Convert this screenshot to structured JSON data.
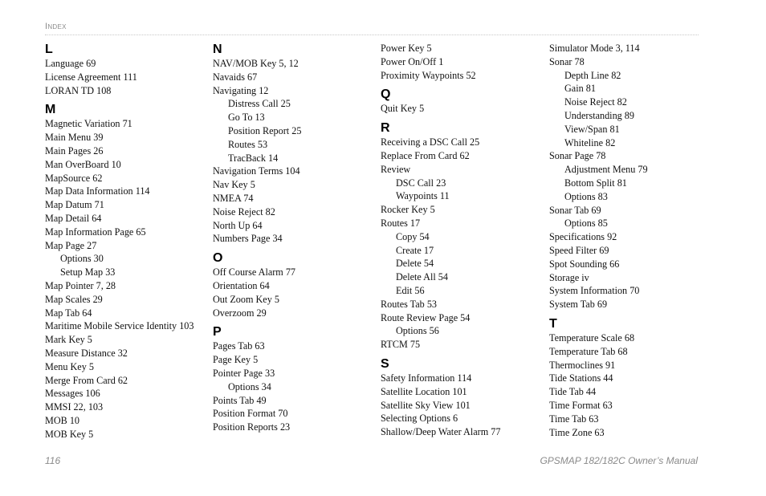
{
  "header": {
    "section_label": "Index"
  },
  "footer": {
    "page_number": "116",
    "manual_title": "GPSMAP 182/182C Owner’s Manual"
  },
  "columns": [
    {
      "sections": [
        {
          "letter": "L",
          "entries": [
            {
              "text": "Language  69",
              "sub": false
            },
            {
              "text": "License Agreement  111",
              "sub": false
            },
            {
              "text": "LORAN TD  108",
              "sub": false
            }
          ]
        },
        {
          "letter": "M",
          "entries": [
            {
              "text": "Magnetic Variation  71",
              "sub": false
            },
            {
              "text": "Main Menu  39",
              "sub": false
            },
            {
              "text": "Main Pages  26",
              "sub": false
            },
            {
              "text": "Man OverBoard  10",
              "sub": false
            },
            {
              "text": "MapSource  62",
              "sub": false
            },
            {
              "text": "Map Data Information  114",
              "sub": false
            },
            {
              "text": "Map Datum  71",
              "sub": false
            },
            {
              "text": "Map Detail  64",
              "sub": false
            },
            {
              "text": "Map Information Page  65",
              "sub": false
            },
            {
              "text": "Map Page  27",
              "sub": false
            },
            {
              "text": "Options  30",
              "sub": true
            },
            {
              "text": "Setup Map  33",
              "sub": true
            },
            {
              "text": "Map Pointer  7, 28",
              "sub": false
            },
            {
              "text": "Map Scales  29",
              "sub": false
            },
            {
              "text": "Map Tab  64",
              "sub": false
            },
            {
              "text": "Maritime Mobile Service Identity  103",
              "sub": false
            },
            {
              "text": "Mark Key  5",
              "sub": false
            },
            {
              "text": "Measure Distance  32",
              "sub": false
            },
            {
              "text": "Menu Key  5",
              "sub": false
            },
            {
              "text": "Merge From Card  62",
              "sub": false
            },
            {
              "text": "Messages  106",
              "sub": false
            },
            {
              "text": "MMSI  22, 103",
              "sub": false
            },
            {
              "text": "MOB  10",
              "sub": false
            },
            {
              "text": "MOB Key  5",
              "sub": false
            }
          ]
        }
      ]
    },
    {
      "sections": [
        {
          "letter": "N",
          "entries": [
            {
              "text": "NAV/MOB Key  5, 12",
              "sub": false
            },
            {
              "text": "Navaids  67",
              "sub": false
            },
            {
              "text": "Navigating  12",
              "sub": false
            },
            {
              "text": "Distress Call  25",
              "sub": true
            },
            {
              "text": "Go To  13",
              "sub": true
            },
            {
              "text": "Position Report  25",
              "sub": true
            },
            {
              "text": "Routes  53",
              "sub": true
            },
            {
              "text": "TracBack  14",
              "sub": true
            },
            {
              "text": "Navigation Terms  104",
              "sub": false
            },
            {
              "text": "Nav Key  5",
              "sub": false
            },
            {
              "text": "NMEA  74",
              "sub": false
            },
            {
              "text": "Noise Reject  82",
              "sub": false
            },
            {
              "text": "North Up  64",
              "sub": false
            },
            {
              "text": "Numbers Page  34",
              "sub": false
            }
          ]
        },
        {
          "letter": "O",
          "entries": [
            {
              "text": "Off Course Alarm  77",
              "sub": false
            },
            {
              "text": "Orientation  64",
              "sub": false
            },
            {
              "text": "Out Zoom Key  5",
              "sub": false
            },
            {
              "text": "Overzoom  29",
              "sub": false
            }
          ]
        },
        {
          "letter": "P",
          "entries": [
            {
              "text": "Pages Tab  63",
              "sub": false
            },
            {
              "text": "Page Key  5",
              "sub": false
            },
            {
              "text": "Pointer Page  33",
              "sub": false
            },
            {
              "text": "Options  34",
              "sub": true
            },
            {
              "text": "Points Tab  49",
              "sub": false
            },
            {
              "text": "Position Format  70",
              "sub": false
            },
            {
              "text": "Position Reports  23",
              "sub": false
            }
          ]
        }
      ]
    },
    {
      "sections": [
        {
          "letter": "",
          "entries": [
            {
              "text": "Power Key  5",
              "sub": false
            },
            {
              "text": "Power On/Off  1",
              "sub": false
            },
            {
              "text": "Proximity Waypoints  52",
              "sub": false
            }
          ]
        },
        {
          "letter": "Q",
          "entries": [
            {
              "text": "Quit Key  5",
              "sub": false
            }
          ]
        },
        {
          "letter": "R",
          "entries": [
            {
              "text": "Receiving a DSC Call  25",
              "sub": false
            },
            {
              "text": "Replace From Card  62",
              "sub": false
            },
            {
              "text": "Review",
              "sub": false
            },
            {
              "text": "DSC Call  23",
              "sub": true
            },
            {
              "text": "Waypoints  11",
              "sub": true
            },
            {
              "text": "Rocker Key  5",
              "sub": false
            },
            {
              "text": "Routes  17",
              "sub": false
            },
            {
              "text": "Copy  54",
              "sub": true
            },
            {
              "text": "Create  17",
              "sub": true
            },
            {
              "text": "Delete  54",
              "sub": true
            },
            {
              "text": "Delete All  54",
              "sub": true
            },
            {
              "text": "Edit  56",
              "sub": true
            },
            {
              "text": "Routes Tab  53",
              "sub": false
            },
            {
              "text": "Route Review Page  54",
              "sub": false
            },
            {
              "text": "Options  56",
              "sub": true
            },
            {
              "text": "RTCM  75",
              "sub": false
            }
          ]
        },
        {
          "letter": "S",
          "entries": [
            {
              "text": "Safety Information  114",
              "sub": false
            },
            {
              "text": "Satellite Location  101",
              "sub": false
            },
            {
              "text": "Satellite Sky View  101",
              "sub": false
            },
            {
              "text": "Selecting Options  6",
              "sub": false
            },
            {
              "text": "Shallow/Deep Water Alarm  77",
              "sub": false
            }
          ]
        }
      ]
    },
    {
      "sections": [
        {
          "letter": "",
          "entries": [
            {
              "text": "Simulator Mode  3, 114",
              "sub": false
            },
            {
              "text": "Sonar  78",
              "sub": false
            },
            {
              "text": "Depth Line  82",
              "sub": true
            },
            {
              "text": "Gain  81",
              "sub": true
            },
            {
              "text": "Noise Reject  82",
              "sub": true
            },
            {
              "text": "Understanding  89",
              "sub": true
            },
            {
              "text": "View/Span  81",
              "sub": true
            },
            {
              "text": "Whiteline  82",
              "sub": true
            },
            {
              "text": "Sonar Page  78",
              "sub": false
            },
            {
              "text": "Adjustment Menu  79",
              "sub": true
            },
            {
              "text": "Bottom Split  81",
              "sub": true
            },
            {
              "text": "Options  83",
              "sub": true
            },
            {
              "text": "Sonar Tab  69",
              "sub": false
            },
            {
              "text": "Options  85",
              "sub": true
            },
            {
              "text": "Specifications  92",
              "sub": false
            },
            {
              "text": "Speed Filter  69",
              "sub": false
            },
            {
              "text": "Spot Sounding  66",
              "sub": false
            },
            {
              "text": "Storage  iv",
              "sub": false
            },
            {
              "text": "System Information  70",
              "sub": false
            },
            {
              "text": "System Tab  69",
              "sub": false
            }
          ]
        },
        {
          "letter": "T",
          "entries": [
            {
              "text": "Temperature Scale  68",
              "sub": false
            },
            {
              "text": "Temperature Tab  68",
              "sub": false
            },
            {
              "text": "Thermoclines  91",
              "sub": false
            },
            {
              "text": "Tide Stations  44",
              "sub": false
            },
            {
              "text": "Tide Tab  44",
              "sub": false
            },
            {
              "text": "Time Format  63",
              "sub": false
            },
            {
              "text": "Time Tab  63",
              "sub": false
            },
            {
              "text": "Time Zone  63",
              "sub": false
            }
          ]
        }
      ]
    }
  ]
}
